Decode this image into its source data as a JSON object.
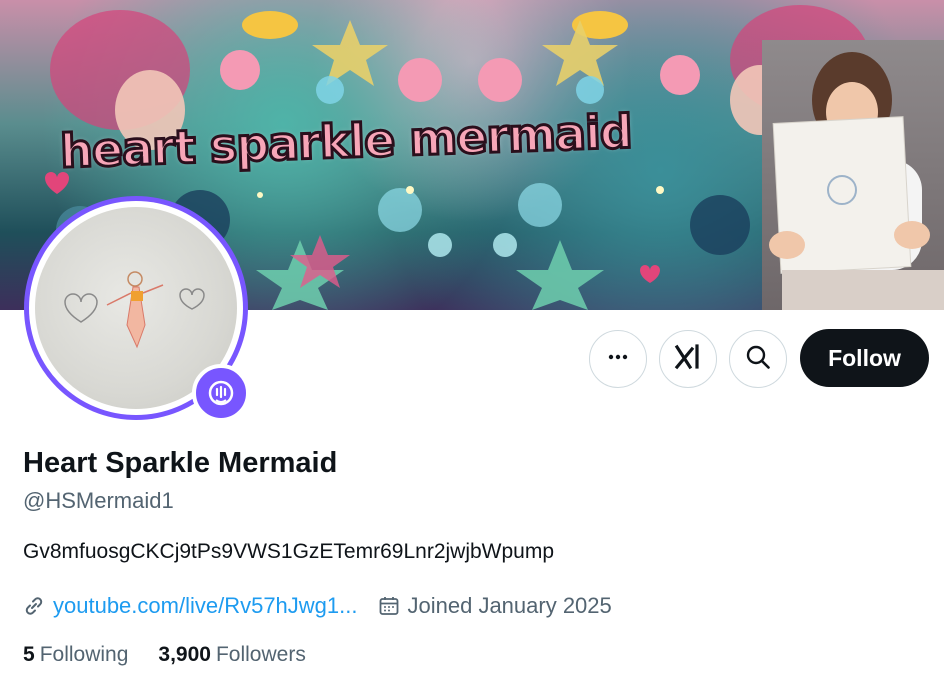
{
  "banner": {
    "title": "heart sparkle mermaid"
  },
  "profile": {
    "display_name": "Heart Sparkle Mermaid",
    "handle": "@HSMermaid1",
    "bio": "Gv8mfuosgCKCj9tPs9VWS1GzETemr69Lnr2jwjbWpump",
    "link_text": "youtube.com/live/Rv57hJwg1...",
    "joined": "Joined January 2025"
  },
  "actions": {
    "more_icon": "more-horizontal-icon",
    "grok_icon": "grok-icon",
    "search_icon": "search-icon",
    "follow_label": "Follow"
  },
  "stats": {
    "following_count": "5",
    "following_label": "Following",
    "followers_count": "3,900",
    "followers_label": "Followers"
  },
  "colors": {
    "accent": "#1d9bf0",
    "avatar_ring": "#7856ff",
    "follow_bg": "#0f1419",
    "secondary_text": "#536471"
  }
}
